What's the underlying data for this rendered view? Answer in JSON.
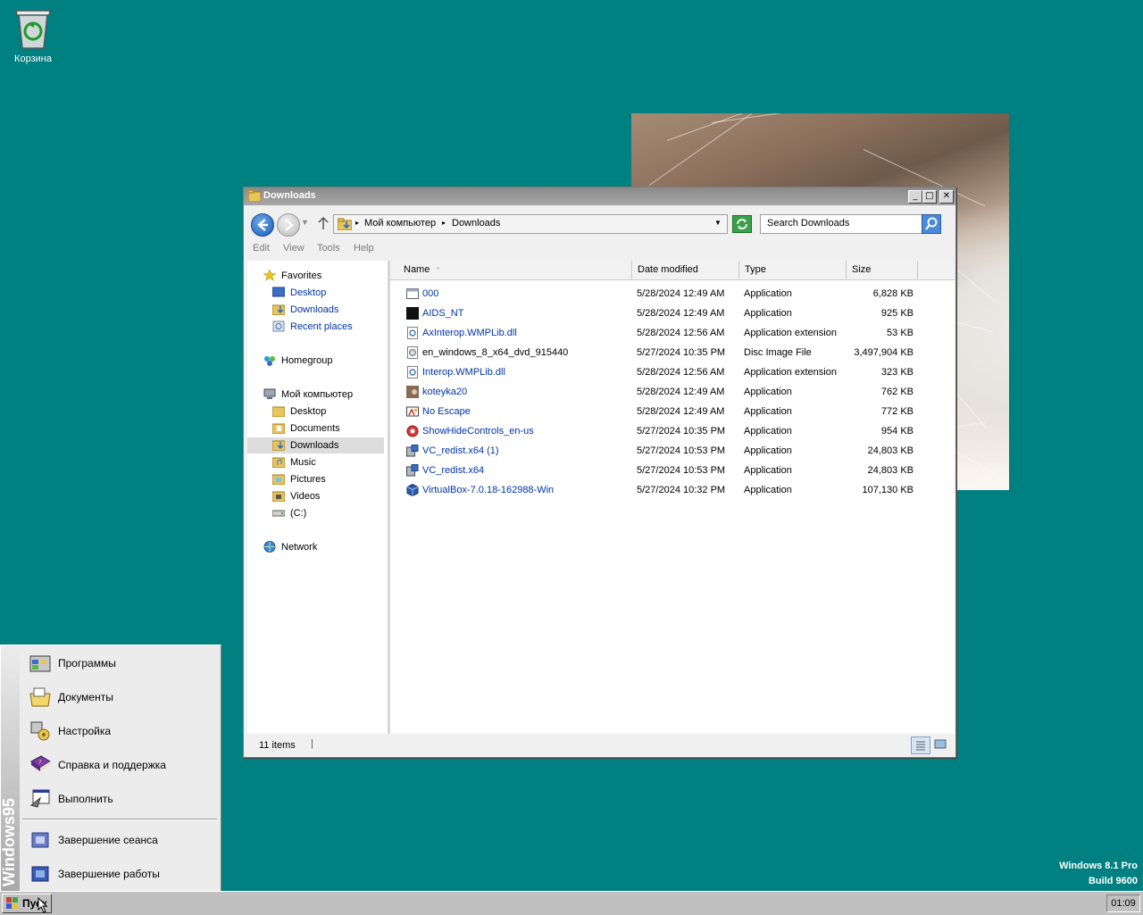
{
  "desktop": {
    "recycle_bin_label": "Корзина",
    "watermark_line1": "Windows 8.1 Pro",
    "watermark_line2": "Build 9600"
  },
  "window": {
    "title": "Downloads",
    "address": {
      "computer": "Мой компьютер",
      "folder": "Downloads"
    },
    "search_placeholder": "Search Downloads",
    "menu": [
      "Edit",
      "View",
      "Tools",
      "Help"
    ],
    "nav": {
      "favorites": "Favorites",
      "fav_items": [
        "Desktop",
        "Downloads",
        "Recent places"
      ],
      "homegroup": "Homegroup",
      "computer": "Мой компьютер",
      "computer_items": [
        "Desktop",
        "Documents",
        "Downloads",
        "Music",
        "Pictures",
        "Videos",
        "(C:)"
      ],
      "network": "Network"
    },
    "columns": {
      "name": "Name",
      "date": "Date modified",
      "type": "Type",
      "size": "Size"
    },
    "files": [
      {
        "name": "000",
        "date": "5/28/2024 12:49 AM",
        "type": "Application",
        "size": "6,828 KB",
        "icon": "app-window-icon"
      },
      {
        "name": "AIDS_NT",
        "date": "5/28/2024 12:49 AM",
        "type": "Application",
        "size": "925 KB",
        "icon": "black-app-icon"
      },
      {
        "name": "AxInterop.WMPLib.dll",
        "date": "5/28/2024 12:56 AM",
        "type": "Application extension",
        "size": "53 KB",
        "icon": "dll-gear-icon"
      },
      {
        "name": "en_windows_8_x64_dvd_915440",
        "date": "5/27/2024 10:35 PM",
        "type": "Disc Image File",
        "size": "3,497,904 KB",
        "icon": "disc-image-icon"
      },
      {
        "name": "Interop.WMPLib.dll",
        "date": "5/28/2024 12:56 AM",
        "type": "Application extension",
        "size": "323 KB",
        "icon": "dll-gear-icon"
      },
      {
        "name": "koteyka20",
        "date": "5/28/2024 12:49 AM",
        "type": "Application",
        "size": "762 KB",
        "icon": "cat-photo-icon"
      },
      {
        "name": "No Escape",
        "date": "5/28/2024 12:49 AM",
        "type": "Application",
        "size": "772 KB",
        "icon": "escape-app-icon"
      },
      {
        "name": "ShowHideControls_en-us",
        "date": "5/27/2024 10:35 PM",
        "type": "Application",
        "size": "954 KB",
        "icon": "red-circle-icon"
      },
      {
        "name": "VC_redist.x64 (1)",
        "date": "5/27/2024 10:53 PM",
        "type": "Application",
        "size": "24,803 KB",
        "icon": "installer-icon"
      },
      {
        "name": "VC_redist.x64",
        "date": "5/27/2024 10:53 PM",
        "type": "Application",
        "size": "24,803 KB",
        "icon": "installer-icon"
      },
      {
        "name": "VirtualBox-7.0.18-162988-Win",
        "date": "5/27/2024 10:32 PM",
        "type": "Application",
        "size": "107,130 KB",
        "icon": "virtualbox-icon"
      }
    ],
    "status_items": "11 items"
  },
  "startmenu": {
    "brand": "Windows95",
    "items": [
      "Программы",
      "Документы",
      "Настройка",
      "Справка и поддержка",
      "Выполнить"
    ],
    "bottom_items": [
      "Завершение сеанса",
      "Завершение работы"
    ]
  },
  "taskbar": {
    "start_label": "Пуск",
    "clock": "01:09"
  }
}
